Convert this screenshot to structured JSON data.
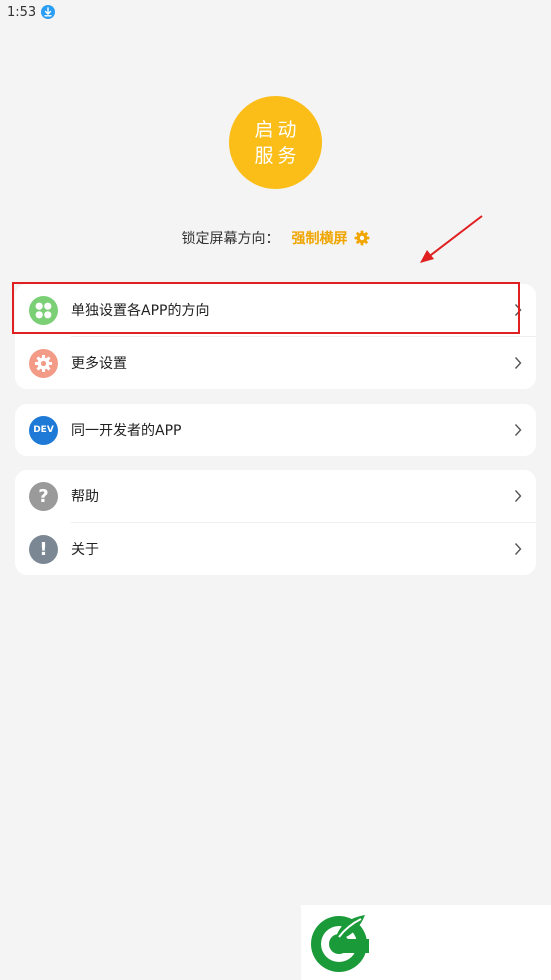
{
  "status_bar": {
    "time": "1:53"
  },
  "start_button": {
    "line1": "启动",
    "line2": "服务"
  },
  "lock_orientation": {
    "label": "锁定屏幕方向：",
    "value": "强制横屏"
  },
  "menu": {
    "group1": [
      {
        "label": "单独设置各APP的方向",
        "icon": "grid-icon",
        "color": "#7bcf75"
      },
      {
        "label": "更多设置",
        "icon": "gear-icon",
        "color": "#f39b86"
      }
    ],
    "group2": [
      {
        "label": "同一开发者的APP",
        "icon": "dev-icon",
        "badge": "DEV",
        "color": "#1e7ad6"
      }
    ],
    "group3": [
      {
        "label": "帮助",
        "icon": "question-icon",
        "glyph": "?",
        "color": "#9a9a9a"
      },
      {
        "label": "关于",
        "icon": "exclamation-icon",
        "glyph": "!",
        "color": "#7b8893"
      }
    ]
  },
  "colors": {
    "accent": "#fbbd18",
    "lock_value": "#f0a500",
    "annotation": "#e02020"
  }
}
